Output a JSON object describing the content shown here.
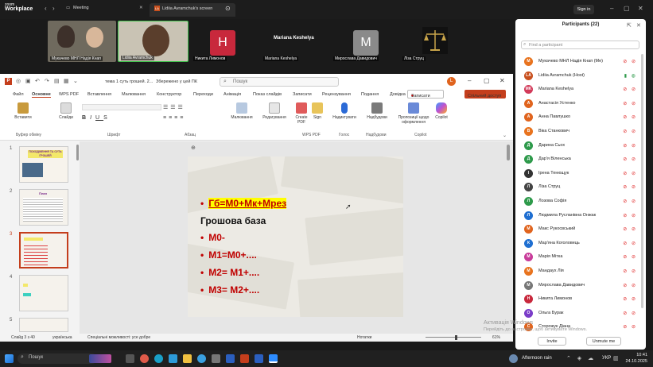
{
  "zoom": {
    "logo_top": "zoom",
    "logo_bottom": "Workplace",
    "tab_meeting": "Meeting",
    "tab_screen": "Lidiia Avramchuk's screen",
    "signin": "Sign in"
  },
  "video_strip": [
    {
      "name": "Мукачево МНЛ Надія Кнап"
    },
    {
      "name": "Lidiia Avramchuk"
    },
    {
      "name": "Никита Лимонов",
      "initial": "H"
    },
    {
      "name": "Mariana Keshelya",
      "title": "Mariana Keshelya"
    },
    {
      "name": "Мирослава Давидович",
      "initial": "M"
    },
    {
      "name": "Ліза Струц"
    }
  ],
  "ppt": {
    "filename": "тема 1 суть грошей. 2...",
    "saved": "Збережено у цей ПК",
    "search_placeholder": "Пошук",
    "user_initial": "L",
    "menu": [
      "Файл",
      "Основне",
      "WPS PDF",
      "Вставлення",
      "Малювання",
      "Конструктор",
      "Переходи",
      "Анімація",
      "Показ слайдів",
      "Записати",
      "Рецензування",
      "Подання",
      "Довідка"
    ],
    "record_btn": "Записати",
    "share_btn": "Спільний доступ",
    "ribbon": {
      "paste": "Вставити",
      "slides": "Слайди",
      "clipboard": "Буфер обміну",
      "font": "Шрифт",
      "paragraph": "Абзац",
      "drawing": "Малювання",
      "editing": "Редагування",
      "create_pdf": "Create PDF",
      "sign": "Sign",
      "wps_pdf": "WPS PDF",
      "dictate": "Надиктувати",
      "voice": "Голос",
      "addins": "Надбудови",
      "addins_group": "Надбудови",
      "designer": "Пропозиції щодо оформлення",
      "copilot": "Copilot",
      "copilot_group": "Copilot"
    },
    "thumb1_title": "ПОХОДЖЕННЯ ТА СУТЬ ГРОШЕЙ",
    "thumb2_title": "План",
    "slide_numbers": [
      "1",
      "2",
      "3",
      "4",
      "5"
    ],
    "slide": {
      "line1": "Гб=М0+Мк+Мрез",
      "heading": "Грошова база",
      "line2": "М0-",
      "line3": "М1=М0+....",
      "line4": "М2= М1+....",
      "line5": "М3= М2+...."
    },
    "status": {
      "slide_of": "Слайд 3 з 40",
      "language": "українська",
      "accessibility": "Спеціальні можливості: усе добре",
      "notes": "Нотатки",
      "zoom": "61%"
    }
  },
  "participants": {
    "header": "Participants (22)",
    "search_placeholder": "Find a participant",
    "list": [
      {
        "name": "Мукачево МНЛ Надія Кнап (Me)",
        "initial": "М",
        "color": "#e8731e"
      },
      {
        "name": "Lidiia Avramchuk (Host)",
        "initial": "LA",
        "color": "#c8501e"
      },
      {
        "name": "Mariana Keshelya",
        "initial": "MK",
        "color": "#d23b5a"
      },
      {
        "name": "Анастасія Устенко",
        "initial": "А",
        "color": "#e0641e"
      },
      {
        "name": "Анна Павлушко",
        "initial": "А",
        "color": "#e0641e"
      },
      {
        "name": "Віка Станкович",
        "initial": "В",
        "color": "#e8731e"
      },
      {
        "name": "Дарина Сьох",
        "initial": "Д",
        "color": "#2e9a4b"
      },
      {
        "name": "Дар'я Віленська",
        "initial": "Д",
        "color": "#2e9a4b"
      },
      {
        "name": "Ірена Тенющук",
        "initial": "І",
        "color": "#333333"
      },
      {
        "name": "Ліза Струц",
        "initial": "Л",
        "color": "#444444"
      },
      {
        "name": "Лозова Софія",
        "initial": "Л",
        "color": "#2e9a4b"
      },
      {
        "name": "Людмила Русланівна Онжак",
        "initial": "Л",
        "color": "#1f6fd1"
      },
      {
        "name": "Макс Рукосвський",
        "initial": "М",
        "color": "#e0641e"
      },
      {
        "name": "Мар'яна Коголовець",
        "initial": "К",
        "color": "#1f6fd1"
      },
      {
        "name": "Марія Мітка",
        "initial": "М",
        "color": "#c83c9a"
      },
      {
        "name": "Мандаух Лія",
        "initial": "М",
        "color": "#e8731e"
      },
      {
        "name": "Мирослава Давидович",
        "initial": "М",
        "color": "#777777"
      },
      {
        "name": "Никита Лимонов",
        "initial": "Н",
        "color": "#c8283c"
      },
      {
        "name": "Ольга Бурак",
        "initial": "О",
        "color": "#7a3cc8"
      },
      {
        "name": "Сторожук Діана",
        "initial": "С",
        "color": "#e0641e"
      }
    ],
    "invite": "Invite",
    "mute_me": "Unmute me"
  },
  "watermark": {
    "line1": "Активація Windows",
    "line2": "Перейдіть до настройки, щоб активувати Windows."
  },
  "taskbar": {
    "search": "Пошук",
    "weather": "Afternoon rain",
    "lang": "УКР",
    "time": "10:41",
    "date": "24.10.2025"
  }
}
